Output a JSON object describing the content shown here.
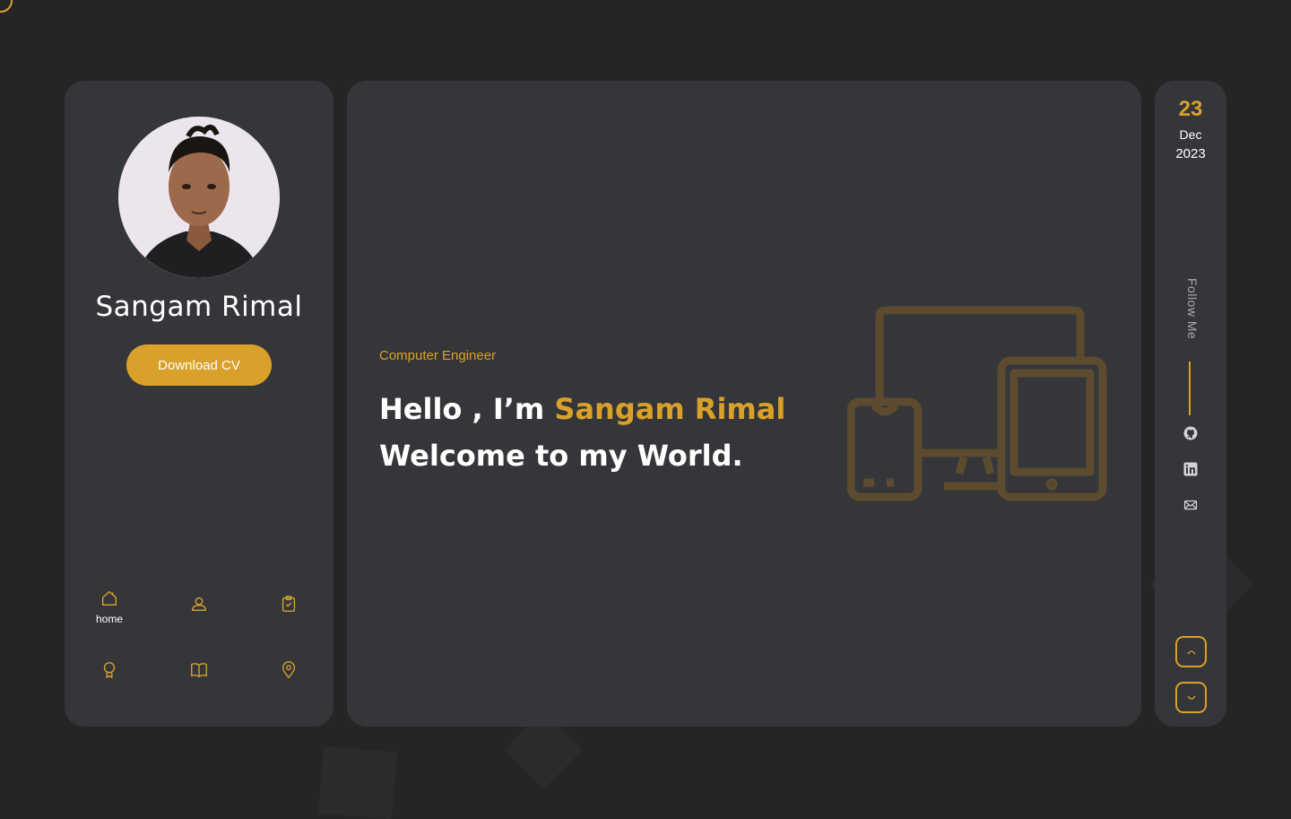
{
  "profile": {
    "name": "Sangam Rimal",
    "cv_button": "Download CV"
  },
  "nav": {
    "items": [
      {
        "icon": "home-icon",
        "label": "home",
        "active": true
      },
      {
        "icon": "user-icon",
        "label": ""
      },
      {
        "icon": "clipboard-check-icon",
        "label": ""
      },
      {
        "icon": "award-icon",
        "label": ""
      },
      {
        "icon": "book-icon",
        "label": ""
      },
      {
        "icon": "location-pin-icon",
        "label": ""
      }
    ]
  },
  "hero": {
    "role": "Computer Engineer",
    "greeting": "Hello , I’m",
    "name": "Sangam Rimal",
    "line2": "Welcome to my World."
  },
  "date": {
    "day": "23",
    "month": "Dec",
    "year": "2023"
  },
  "follow": {
    "label": "Follow Me",
    "links": [
      "github-icon",
      "linkedin-icon",
      "mail-icon"
    ]
  },
  "colors": {
    "accent": "#d9a12a",
    "card": "#35363a",
    "background": "#252526"
  }
}
